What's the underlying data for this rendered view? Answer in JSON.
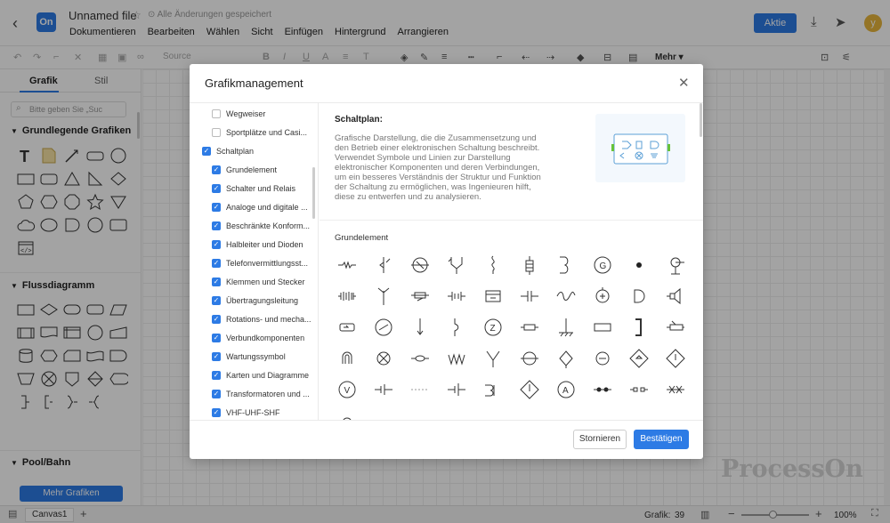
{
  "header": {
    "back_icon": "chevron-left-icon",
    "logo_text": "On",
    "file_name": "Unnamed file",
    "saved_status": "Alle Änderungen gespeichert",
    "menu": [
      "Dokumentieren",
      "Bearbeiten",
      "Wählen",
      "Sicht",
      "Einfügen",
      "Hintergrund",
      "Arrangieren"
    ],
    "action_button": "Aktie",
    "avatar_letter": "y"
  },
  "toolbar": {
    "source_label": "Source",
    "more_label": "Mehr"
  },
  "left_panel": {
    "tabs": [
      "Grafik",
      "Stil"
    ],
    "search_placeholder": "Bitte geben Sie „Suc",
    "sections": [
      "Grundlegende Grafiken",
      "Flussdiagramm",
      "Pool/Bahn"
    ],
    "more_button": "Mehr Grafiken"
  },
  "status_bar": {
    "canvas_tab": "Canvas1",
    "shape_count_label": "Grafik:",
    "shape_count": "39",
    "zoom": "100%"
  },
  "watermark": "ProcessOn",
  "dialog": {
    "title": "Grafikmanagement",
    "tree": [
      {
        "label": "Wegweiser",
        "checked": false,
        "level": 1
      },
      {
        "label": "Sportplätze und Casi...",
        "checked": false,
        "level": 1
      },
      {
        "label": "Schaltplan",
        "checked": true,
        "level": 0
      },
      {
        "label": "Grundelement",
        "checked": true,
        "level": 1
      },
      {
        "label": "Schalter und Relais",
        "checked": true,
        "level": 1
      },
      {
        "label": "Analoge und digitale ...",
        "checked": true,
        "level": 1
      },
      {
        "label": "Beschränkte Konform...",
        "checked": true,
        "level": 1
      },
      {
        "label": "Halbleiter und Dioden",
        "checked": true,
        "level": 1
      },
      {
        "label": "Telefonvermittlungsst...",
        "checked": true,
        "level": 1
      },
      {
        "label": "Klemmen und Stecker",
        "checked": true,
        "level": 1
      },
      {
        "label": "Übertragungsleitung",
        "checked": true,
        "level": 1
      },
      {
        "label": "Rotations- und mecha...",
        "checked": true,
        "level": 1
      },
      {
        "label": "Verbundkomponenten",
        "checked": true,
        "level": 1
      },
      {
        "label": "Wartungssymbol",
        "checked": true,
        "level": 1
      },
      {
        "label": "Karten und Diagramme",
        "checked": true,
        "level": 1
      },
      {
        "label": "Transformatoren und ...",
        "checked": true,
        "level": 1
      },
      {
        "label": "VHF-UHF-SHF",
        "checked": true,
        "level": 1
      }
    ],
    "detail_title": "Schaltplan:",
    "detail_desc": "Grafische Darstellung, die die Zusammensetzung und den Betrieb einer elektronischen Schaltung beschreibt. Verwendet Symbole und Linien zur Darstellung elektronischer Komponenten und deren Verbindungen, um ein besseres Verständnis der Struktur und Funktion der Schaltung zu ermöglichen, was Ingenieuren hilft, diese zu entwerfen und zu analysieren.",
    "group_label": "Grundelement",
    "cancel_button": "Stornieren",
    "confirm_button": "Bestätigen",
    "symbol_texts": {
      "g": "G",
      "z": "Z",
      "v": "V",
      "a": "A"
    }
  }
}
